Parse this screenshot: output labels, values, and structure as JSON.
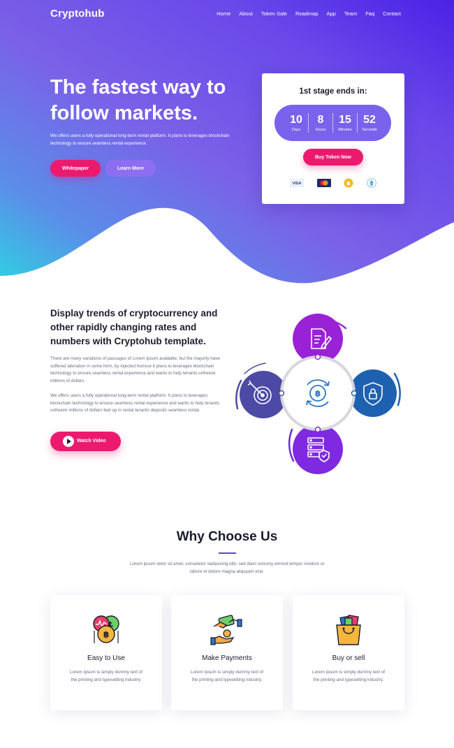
{
  "nav": {
    "logo": "Cryptohub",
    "links": [
      "Home",
      "About",
      "Token Sale",
      "Roadmap",
      "App",
      "Team",
      "Faq",
      "Contact"
    ]
  },
  "hero": {
    "title": "The fastest way to follow markets.",
    "description": "We offers users a fully operational long-term rental platform. It plans to leverages blockchain technology to ensure seamless rental experience.",
    "primary_button": "Whitepaper",
    "secondary_button": "Learn More"
  },
  "countdown": {
    "title": "1st stage ends in:",
    "units": [
      {
        "value": "10",
        "label": "Days"
      },
      {
        "value": "8",
        "label": "Hours"
      },
      {
        "value": "15",
        "label": "Minutes"
      },
      {
        "value": "52",
        "label": "Seconds"
      }
    ],
    "buy_button": "Buy Token Now",
    "payment_icons": [
      "visa-icon",
      "mastercard-icon",
      "bitcoin-icon",
      "ethereum-icon"
    ],
    "visa_text": "VISA"
  },
  "about": {
    "title": "Display trends of cryptocurrency and other rapidly changing rates and numbers with Cryptohub template.",
    "paragraph1": "There are many variations of passages of Lorem Ipsum available, but the majority have suffered alteration in some form, by injected humour.It plans to leverages blockchain technology to ensure seamless rental experience and wants to help tenants unfreeze millions of dollars.",
    "paragraph2": "We offers users a fully operational long-term rental platform. It plans to leverages blockchain technology to ensure seamless rental experience and wants to help tenants unfreeze millions of dollars tied up in rental tenants deposits seamless rental.",
    "video_button": "Watch Video",
    "diagram_icons": [
      "document-edit-icon",
      "target-icon",
      "bitcoin-exchange-icon",
      "shield-lock-icon",
      "server-shield-icon"
    ]
  },
  "why": {
    "title": "Why Choose Us",
    "description": "Lorem ipsum dolor sit amet, consetetur sadipscing elitr, sed diam nonumy eirmod tempor invidunt ut labore et dolore magna aliquyam erat.",
    "cards": [
      {
        "icon": "crypto-coins-icon",
        "title": "Easy to Use",
        "text": "Lorem Ipsum is simply dummy text of the printing and typesetting industry."
      },
      {
        "icon": "hand-payment-icon",
        "title": "Make Payments",
        "text": "Lorem Ipsum is simply dummy text of the printing and typesetting industry."
      },
      {
        "icon": "shopping-bag-icon",
        "title": "Buy or sell",
        "text": "Lorem Ipsum is simply dummy text of the printing and typesetting industry."
      }
    ]
  },
  "colors": {
    "accent_pink": "#ec1a6f",
    "purple": "#5a3de6",
    "light_purple": "#7a62ec",
    "cyan": "#36c7e0"
  }
}
